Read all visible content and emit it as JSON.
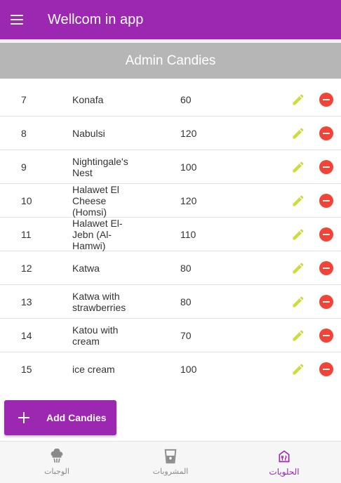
{
  "app": {
    "title": "Wellcom in app",
    "accent": "#9c27b0"
  },
  "section": {
    "title": "Admin Candies"
  },
  "items": [
    {
      "id": "7",
      "name": "Konafa",
      "price": "60"
    },
    {
      "id": "8",
      "name": "Nabulsi",
      "price": "120"
    },
    {
      "id": "9",
      "name": "Nightingale's Nest",
      "price": "100"
    },
    {
      "id": "10",
      "name": "Halawet El Cheese (Homsi)",
      "price": "120"
    },
    {
      "id": "11",
      "name": "Halawet El-Jebn (Al-Hamwi)",
      "price": "110"
    },
    {
      "id": "12",
      "name": "Katwa",
      "price": "80"
    },
    {
      "id": "13",
      "name": "Katwa with strawberries",
      "price": "80"
    },
    {
      "id": "14",
      "name": "Katou with cream",
      "price": "70"
    },
    {
      "id": "15",
      "name": "ice cream",
      "price": "100"
    }
  ],
  "row_actions": {
    "edit_icon": "pencil-icon",
    "delete_icon": "remove-circle-icon",
    "edit_color": "#cddc39",
    "delete_color": "#f44336"
  },
  "add_button": {
    "label": "Add Candies",
    "icon": "plus-icon"
  },
  "bottom_nav": [
    {
      "label": "الوجبات",
      "icon": "cloud-food-icon",
      "active": false
    },
    {
      "label": "المشروبات",
      "icon": "cup-icon",
      "active": false
    },
    {
      "label": "الحلويات",
      "icon": "store-icon",
      "active": true
    }
  ]
}
